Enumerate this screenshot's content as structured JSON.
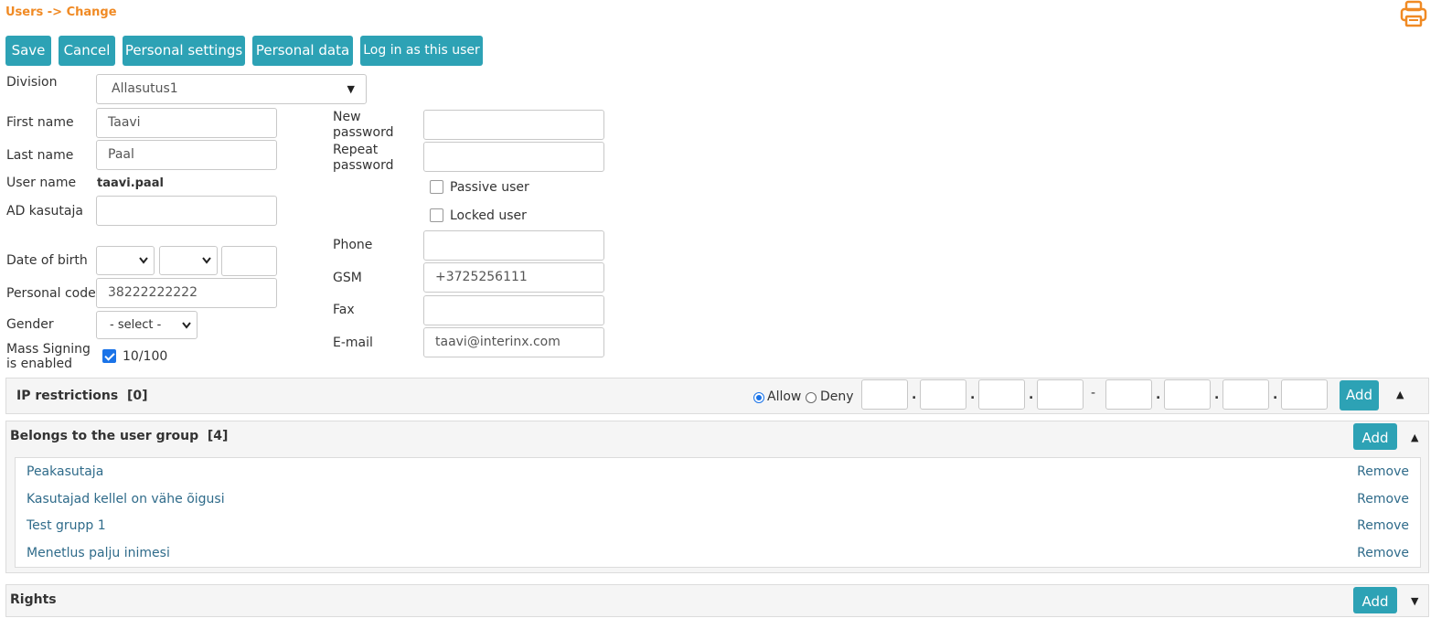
{
  "breadcrumb": "Users -> Change",
  "toolbar": {
    "save": "Save",
    "cancel": "Cancel",
    "personal_settings": "Personal settings",
    "personal_data": "Personal data",
    "login_as": "Log in as this user"
  },
  "form": {
    "division_label": "Division",
    "division_value": "Allasutus1",
    "first_name_label": "First name",
    "first_name_value": "Taavi",
    "last_name_label": "Last name",
    "last_name_value": "Paal",
    "user_name_label": "User name",
    "user_name_value": "taavi.paal",
    "ad_label": "AD kasutaja",
    "ad_value": "",
    "dob_label": "Date of birth",
    "personal_code_label": "Personal code",
    "personal_code_value": "38222222222",
    "gender_label": "Gender",
    "gender_value": "- select -",
    "mass_signing_label_1": "Mass Signing",
    "mass_signing_label_2": "is enabled",
    "mass_signing_checked": true,
    "mass_signing_value": "10/100",
    "new_password_label_1": "New",
    "new_password_label_2": "password",
    "repeat_password_label_1": "Repeat",
    "repeat_password_label_2": "password",
    "passive_label": "Passive user",
    "locked_label": "Locked user",
    "phone_label": "Phone",
    "phone_value": "",
    "gsm_label": "GSM",
    "gsm_value": "+3725256111",
    "fax_label": "Fax",
    "fax_value": "",
    "email_label": "E-mail",
    "email_value": "taavi@interinx.com"
  },
  "ip": {
    "title": "IP restrictions",
    "count": "[0]",
    "allow": "Allow",
    "deny": "Deny",
    "add": "Add",
    "dash": "-",
    "dot": "."
  },
  "groups": {
    "title": "Belongs to the user group",
    "count": "[4]",
    "add": "Add",
    "items": [
      {
        "name": "Peakasutaja",
        "action": "Remove"
      },
      {
        "name": "Kasutajad kellel on vähe õigusi",
        "action": "Remove"
      },
      {
        "name": "Test grupp 1",
        "action": "Remove"
      },
      {
        "name": "Menetlus palju inimesi",
        "action": "Remove"
      }
    ]
  },
  "rights": {
    "title": "Rights",
    "add": "Add"
  },
  "colors": {
    "accent": "#2da2b5",
    "breadcrumb": "#f08a24",
    "link": "#2f6b8a"
  }
}
